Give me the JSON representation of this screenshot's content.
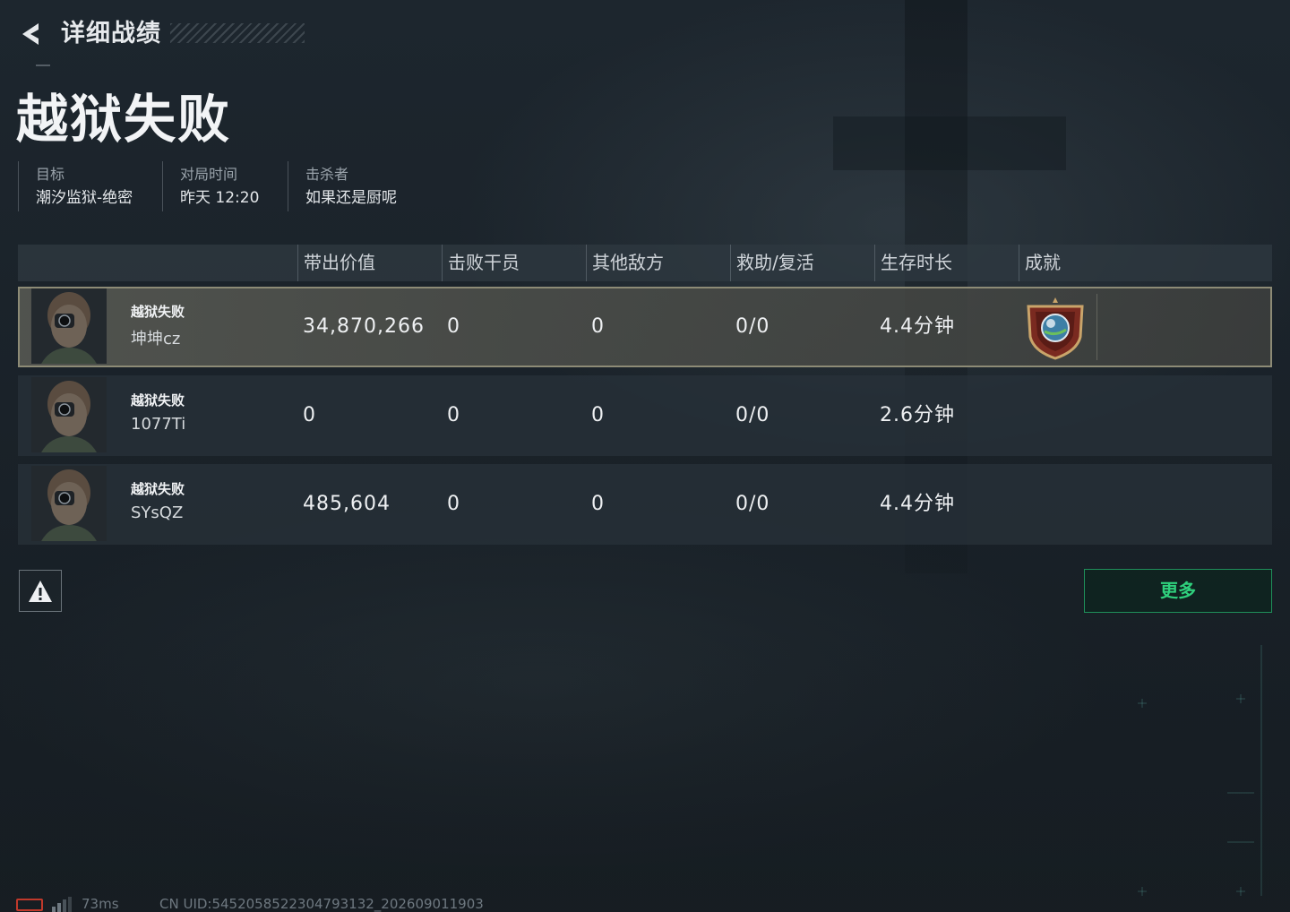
{
  "header": {
    "title": "详细战绩"
  },
  "result": {
    "title": "越狱失败"
  },
  "info": [
    {
      "label": "目标",
      "value": "潮汐监狱-绝密"
    },
    {
      "label": "对局时间",
      "value": "昨天 12:20"
    },
    {
      "label": "击杀者",
      "value": "如果还是厨呢"
    }
  ],
  "table": {
    "headers": [
      "带出价值",
      "击败干员",
      "其他敌方",
      "救助/复活",
      "生存时长",
      "成就"
    ],
    "rows": [
      {
        "status": "越狱失败",
        "name": "坤坤cz",
        "value": "34,870,266",
        "kills": "0",
        "other": "0",
        "assist": "0/0",
        "survival": "4.4分钟",
        "achievement": "shield-medal-icon"
      },
      {
        "status": "越狱失败",
        "name": "1077Ti",
        "value": "0",
        "kills": "0",
        "other": "0",
        "assist": "0/0",
        "survival": "2.6分钟"
      },
      {
        "status": "越狱失败",
        "name": "SYsQZ",
        "value": "485,604",
        "kills": "0",
        "other": "0",
        "assist": "0/0",
        "survival": "4.4分钟"
      }
    ]
  },
  "actions": {
    "more_label": "更多",
    "report_icon": "warning-icon"
  },
  "footer": {
    "ping": "73ms",
    "uid": "CN UID:5452058522304793132_202609011903"
  },
  "colors": {
    "accent_green": "#2fd07c",
    "highlight_border": "#8d8b76",
    "battery_red": "#c0392b"
  }
}
